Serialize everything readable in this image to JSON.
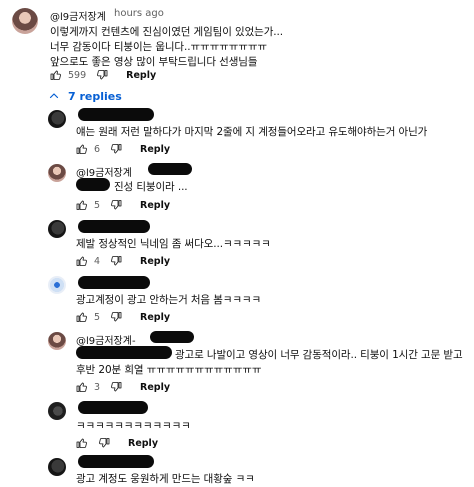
{
  "top_comment": {
    "handle": "@l9금저장계",
    "time": "hours ago",
    "lines": [
      "이렇게까지 컨텐츠에 진심이였던 게임팀이 있었는가...",
      "너무 감동이다 티붕이는 웁니다..ㅠㅠㅠㅠㅠㅠㅠㅠ",
      "앞으로도 좋은 영상 많이 부탁드립니다 선생님들"
    ],
    "likes": "599",
    "reply_label": "Reply"
  },
  "replies_toggle": {
    "label": "7 replies",
    "icon": "chevron-up-icon",
    "color": "#065fd4"
  },
  "replies": [
    {
      "handle": "",
      "lines": [
        "얘는 원래 저런 말하다가 마지막 2줄에 지 계정들어오라고 유도해야하는거 아닌가"
      ],
      "likes": "6",
      "reply_label": "Reply"
    },
    {
      "handle": "@l9금저장계",
      "lines": [
        "진성 티붕이라 ..."
      ],
      "likes": "5",
      "reply_label": "Reply"
    },
    {
      "handle": "",
      "lines": [
        "제발 정상적인 닉네임 좀 써다오...ㅋㅋㅋㅋㅋ"
      ],
      "likes": "4",
      "reply_label": "Reply"
    },
    {
      "handle": "",
      "lines": [
        "광고계정이 광고 안하는거 처음 봄ㅋㅋㅋㅋ"
      ],
      "likes": "5",
      "reply_label": "Reply"
    },
    {
      "handle": "@l9금저장계-",
      "lines": [
        "광고로 나발이고 영상이 너무 감동적이라.. 티붕이 1시간 고문 받고",
        "후반 20분 희열 ㅠㅠㅠㅠㅠㅠㅠㅠㅠㅠㅠㅠ"
      ],
      "likes": "3",
      "reply_label": "Reply"
    },
    {
      "handle": "",
      "lines": [
        "ㅋㅋㅋㅋㅋㅋㅋㅋㅋㅋㅋㅋ"
      ],
      "likes": "",
      "reply_label": "Reply"
    },
    {
      "handle": "",
      "lines": [
        "광고 계정도 웅원하게 만드는 대황숲 ㅋㅋ"
      ],
      "likes": "",
      "reply_label": "Reply"
    }
  ]
}
